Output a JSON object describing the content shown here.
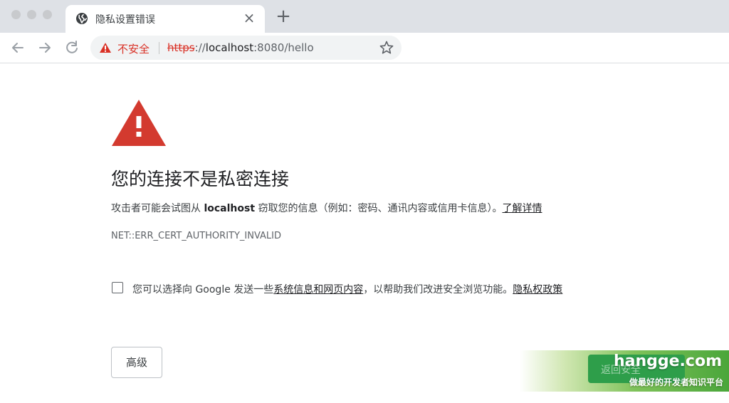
{
  "tab": {
    "title": "隐私设置错误",
    "close_glyph": "×",
    "new_tab_glyph": "+"
  },
  "omnibox": {
    "security_label": "不安全",
    "url_scheme": "https",
    "url_sep": "://",
    "url_host": "localhost",
    "url_rest": ":8080/hello"
  },
  "interstitial": {
    "heading": "您的连接不是私密连接",
    "desc_prefix": "攻击者可能会试图从 ",
    "desc_host": "localhost",
    "desc_suffix": " 窃取您的信息（例如：密码、通讯内容或信用卡信息）。",
    "learn_more": "了解详情",
    "error_code": "NET::ERR_CERT_AUTHORITY_INVALID",
    "optin_prefix": "您可以选择向 Google 发送一些",
    "optin_link": "系统信息和网页内容",
    "optin_middle": "，以帮助我们改进安全浏览功能。",
    "privacy_link": "隐私权政策",
    "optin_checked": false,
    "advanced_button": "高级",
    "back_button": "返回安全"
  },
  "watermark": {
    "brand": "hangge.com",
    "tagline": "做最好的开发者知识平台"
  },
  "colors": {
    "danger": "#d93025",
    "warning_icon": "#d33a2f",
    "tabstrip": "#dee1e6",
    "omnibox": "#f1f3f4"
  },
  "icons": {
    "favicon": "globe-icon",
    "back": "arrow-left-icon",
    "forward": "arrow-right-icon",
    "reload": "reload-icon",
    "security": "warning-triangle-icon",
    "bookmark": "star-icon",
    "main": "warning-triangle-icon"
  }
}
